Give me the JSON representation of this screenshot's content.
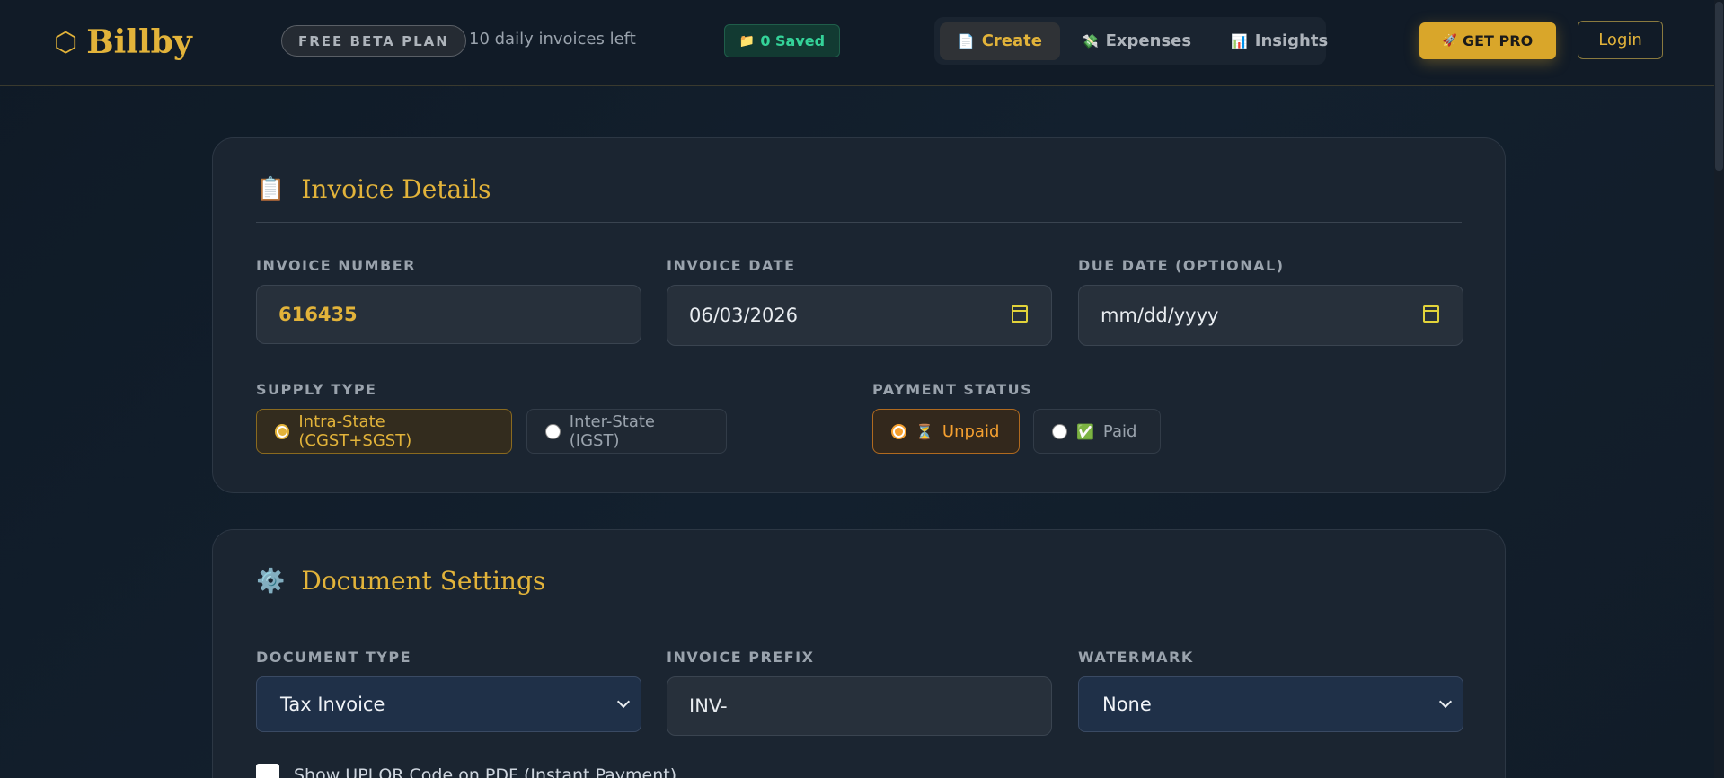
{
  "header": {
    "logo_text": "Billby",
    "logo_icon": "⬡",
    "plan_badge": "FREE BETA PLAN",
    "invoices_left": "10 daily invoices left",
    "saved": "0 Saved",
    "saved_icon": "📁",
    "get_pro": "GET PRO",
    "get_pro_icon": "🚀",
    "login": "Login"
  },
  "nav": {
    "tabs": [
      {
        "label": "Create",
        "icon": "📄",
        "active": true
      },
      {
        "label": "Expenses",
        "icon": "💸",
        "active": false
      },
      {
        "label": "Insights",
        "icon": "📊",
        "active": false
      }
    ]
  },
  "invoice_details": {
    "title": "Invoice Details",
    "icon": "📋",
    "invoice_number_label": "INVOICE NUMBER",
    "invoice_number": "616435",
    "invoice_date_label": "INVOICE DATE",
    "invoice_date": "06/03/2026",
    "due_date_label": "DUE DATE (OPTIONAL)",
    "due_date_placeholder": "mm/dd/yyyy",
    "supply_type_label": "SUPPLY TYPE",
    "supply_options": [
      "Intra-State (CGST+SGST)",
      "Inter-State (IGST)"
    ],
    "supply_selected": "Intra-State (CGST+SGST)",
    "payment_status_label": "PAYMENT STATUS",
    "payment_options": [
      {
        "label": "Unpaid",
        "icon": "⏳"
      },
      {
        "label": "Paid",
        "icon": "✅"
      }
    ],
    "payment_selected": "Unpaid"
  },
  "document_settings": {
    "title": "Document Settings",
    "icon": "⚙️",
    "document_type_label": "DOCUMENT TYPE",
    "document_type": "Tax Invoice",
    "invoice_prefix_label": "INVOICE PREFIX",
    "invoice_prefix": "INV-",
    "watermark_label": "WATERMARK",
    "watermark": "None",
    "upi_qr_label": "Show UPI QR Code on PDF (Instant Payment)"
  },
  "colors": {
    "accent_gold": "#e2b33a",
    "saved_green": "#34d399",
    "unpaid_orange": "#f5a030",
    "background": "#111b27"
  }
}
